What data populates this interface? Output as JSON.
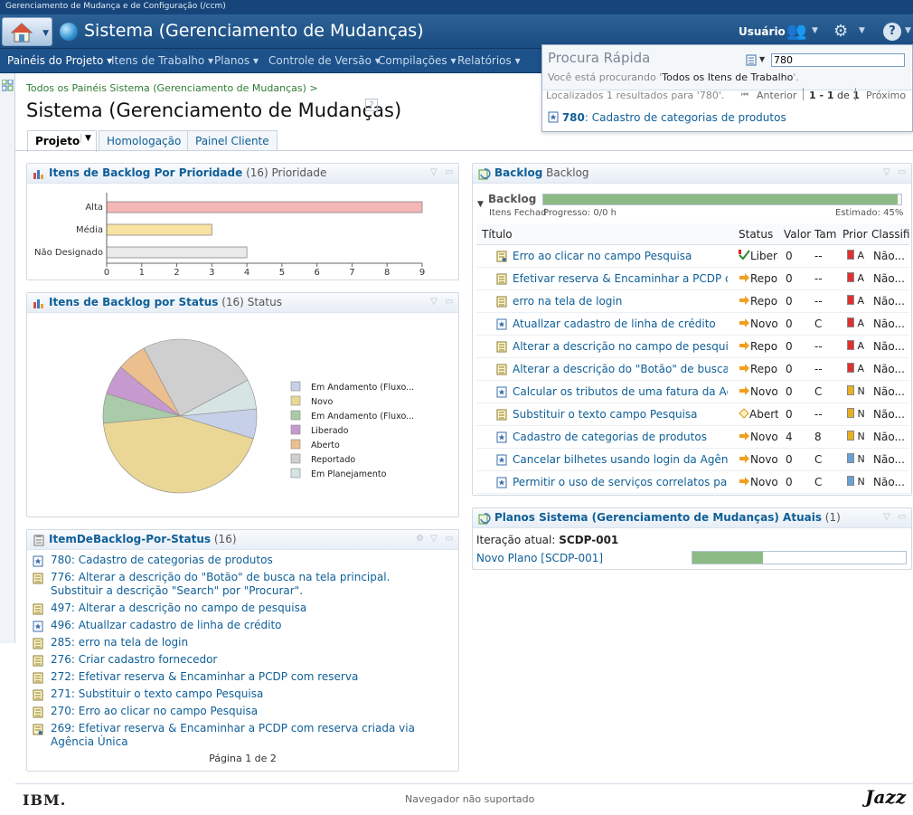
{
  "window": {
    "title": "Gerenciamento de Mudança e de Configuração (/ccm)"
  },
  "header": {
    "app_title": "Sistema (Gerenciamento de Mudanças)",
    "user_label": "Usuário"
  },
  "nav": {
    "items": [
      "Painéis do Projeto",
      "Itens de Trabalho",
      "Planos",
      "Controle de Versão",
      "Compilações",
      "Relatórios"
    ]
  },
  "breadcrumb": "Todos os Painéis Sistema (Gerenciamento de Mudanças) >",
  "page_title": "Sistema (Gerenciamento de Mudanças)",
  "help": "?",
  "tabs": [
    "Projeto",
    "Homologação",
    "Painel Cliente"
  ],
  "quick_search": {
    "title": "Procura Rápida",
    "query": "780",
    "scope_prefix": "Você está procurando '",
    "scope": "Todos os Itens de Trabalho",
    "scope_suffix": "'.",
    "found": "Localizados 1 resultados para '780'.",
    "prev": "Anterior",
    "pager_range": "1 - 1",
    "pager_of": "de",
    "pager_total": "1",
    "next": "Próximo",
    "result_id": "780",
    "result_sep": ":",
    "result_text": " Cadastro de categorias de produtos"
  },
  "widget_priority": {
    "title": "Itens de Backlog Por Prioridade",
    "count": "(16)",
    "suffix": "Prioridade"
  },
  "widget_status": {
    "title": "Itens de Backlog por Status",
    "count": "(16)",
    "suffix": "Status"
  },
  "widget_list": {
    "title": "ItemDeBacklog-Por-Status",
    "count": "(16)",
    "items": [
      {
        "icon": "story-icon",
        "text": "780: Cadastro de categorias de produtos"
      },
      {
        "icon": "task-icon",
        "text": "776: Alterar a descrição do \"Botão\" de busca na tela principal. Substituir a descrição \"Search\" por \"Procurar\"."
      },
      {
        "icon": "task-icon",
        "text": "497: Alterar a descrição no campo de pesquisa"
      },
      {
        "icon": "story-icon",
        "text": "496: Atuallzar cadastro de linha de crédito"
      },
      {
        "icon": "task-icon",
        "text": "285: erro na tela de login"
      },
      {
        "icon": "task-icon",
        "text": "276: Criar cadastro fornecedor"
      },
      {
        "icon": "task-icon",
        "text": "272: Efetivar reserva & Encaminhar a PCDP com reserva"
      },
      {
        "icon": "task-icon",
        "text": "271: Substituir o texto campo Pesquisa"
      },
      {
        "icon": "task-icon",
        "text": "270: Erro ao clicar no campo Pesquisa"
      },
      {
        "icon": "defect-icon",
        "text": "269: Efetivar reserva & Encaminhar a PCDP com reserva criada via Agência Única"
      }
    ],
    "pager": "Página 1 de 2"
  },
  "widget_backlog": {
    "title": "Backlog",
    "suffix": "Backlog",
    "section": "Backlog",
    "closed_label": "Itens Fechad",
    "progress_label": "Progresso: 0/0 h",
    "estimate_label": "Estimado: 45%",
    "progress_value": 0.99,
    "columns": [
      "Título",
      "Status",
      "Valor",
      "Tam",
      "Prior",
      "Classifi"
    ],
    "rows": [
      {
        "type": "defect-icon",
        "title": "Erro ao clicar no campo Pesquisa",
        "status_icon": "check-icon",
        "status": "Liberado",
        "value": "0",
        "size": "--",
        "prio_color": "#e03030",
        "prio": "A",
        "cls": "Não..."
      },
      {
        "type": "task-icon",
        "title": "Efetivar reserva & Encaminhar a PCDP c...",
        "status_icon": "arrow-icon",
        "status": "Reportado",
        "value": "0",
        "size": "--",
        "prio_color": "#e03030",
        "prio": "A",
        "cls": "Não..."
      },
      {
        "type": "task-icon",
        "title": "erro na tela de login",
        "status_icon": "arrow-icon",
        "status": "Reportado",
        "value": "0",
        "size": "--",
        "prio_color": "#e03030",
        "prio": "A",
        "cls": "Não..."
      },
      {
        "type": "story-icon",
        "title": "Atuallzar cadastro de linha de crédito",
        "status_icon": "arrow-icon",
        "status": "Novo",
        "value": "0",
        "size": "C",
        "prio_color": "#e03030",
        "prio": "A",
        "cls": "Não..."
      },
      {
        "type": "task-icon",
        "title": "Alterar a descrição no campo de pesquisa",
        "status_icon": "arrow-icon",
        "status": "Reportado",
        "value": "0",
        "size": "--",
        "prio_color": "#e03030",
        "prio": "A",
        "cls": "Não..."
      },
      {
        "type": "task-icon",
        "title": "Alterar a descrição do \"Botão\" de busca n...",
        "status_icon": "arrow-icon",
        "status": "Reportado",
        "value": "0",
        "size": "--",
        "prio_color": "#e03030",
        "prio": "A",
        "cls": "Não..."
      },
      {
        "type": "story-icon",
        "title": "Calcular os tributos de uma fatura da Agê...",
        "status_icon": "arrow-icon",
        "status": "Novo",
        "value": "0",
        "size": "C",
        "prio_color": "#e8b020",
        "prio": "N",
        "cls": "Não..."
      },
      {
        "type": "task-icon",
        "title": "Substituir o texto campo Pesquisa",
        "status_icon": "diamond-icon",
        "status": "Aberto",
        "value": "0",
        "size": "--",
        "prio_color": "#e8b020",
        "prio": "N",
        "cls": "Não..."
      },
      {
        "type": "story-icon",
        "title": "Cadastro de categorias de produtos",
        "status_icon": "arrow-icon",
        "status": "Novo",
        "value": "4",
        "size": "8",
        "prio_color": "#e8b020",
        "prio": "N",
        "cls": "Não..."
      },
      {
        "type": "story-icon",
        "title": "Cancelar bilhetes usando login da Agên...",
        "status_icon": "arrow-icon",
        "status": "Novo",
        "value": "0",
        "size": "C",
        "prio_color": "#6aa0d8",
        "prio": "N",
        "cls": "Não..."
      },
      {
        "type": "story-icon",
        "title": "Permitir o uso de serviços correlatos par...",
        "status_icon": "arrow-icon",
        "status": "Novo",
        "value": "0",
        "size": "C",
        "prio_color": "#6aa0d8",
        "prio": "N",
        "cls": "Não..."
      }
    ]
  },
  "widget_plans": {
    "title": "Planos Sistema (Gerenciamento de Mudanças) Atuais",
    "count": "(1)",
    "iter_label": "Iteração atual:",
    "iter_value": "SCDP-001",
    "plan_link": "Novo Plano [SCDP-001]",
    "plan_progress": 0.33
  },
  "footer": {
    "ibm": "IBM.",
    "status": "Navegador não suportado",
    "jazz": "Jazz"
  },
  "chart_data": [
    {
      "type": "bar",
      "orientation": "horizontal",
      "categories": [
        "Alta",
        "Média",
        "Não Designado"
      ],
      "values": [
        9,
        3,
        4
      ],
      "xlim": [
        0,
        9
      ],
      "xticks": [
        "0",
        "1",
        "2",
        "3",
        "4",
        "5",
        "6",
        "7",
        "8",
        "9"
      ],
      "colors": [
        "#f4b6b6",
        "#f9e3a4",
        "#eaeaea"
      ],
      "grid": false
    },
    {
      "type": "pie",
      "labels": [
        "Em Andamento (Fluxo...",
        "Novo",
        "Em Andamento (Fluxo...",
        "Liberado",
        "Aberto",
        "Reportado",
        "Em Planejamento"
      ],
      "values": [
        1,
        7,
        1,
        1,
        1,
        4,
        1
      ],
      "colors": [
        "#c6d0e8",
        "#ead796",
        "#a9cba9",
        "#c79acf",
        "#ecbf8e",
        "#cfcfcf",
        "#d6e4e4"
      ],
      "legend": "right"
    }
  ]
}
